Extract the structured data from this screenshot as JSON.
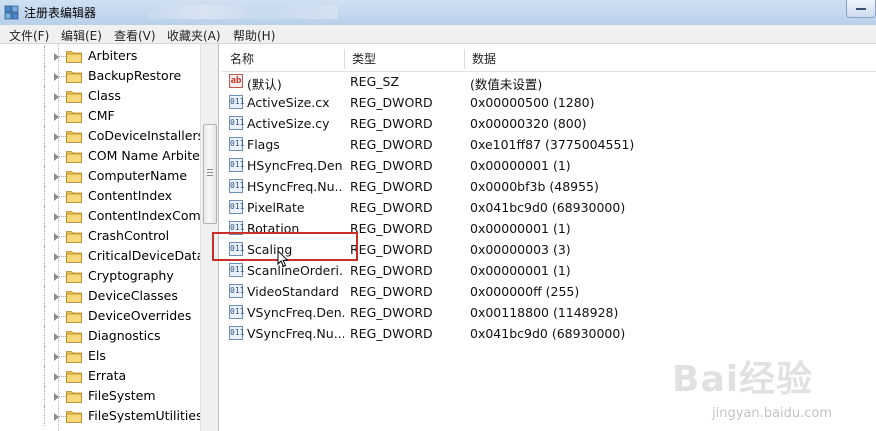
{
  "window": {
    "title": "注册表编辑器"
  },
  "menu": [
    {
      "label": "文件(F)"
    },
    {
      "label": "编辑(E)"
    },
    {
      "label": "查看(V)"
    },
    {
      "label": "收藏夹(A)"
    },
    {
      "label": "帮助(H)"
    }
  ],
  "tree": {
    "items": [
      {
        "label": "Arbiters"
      },
      {
        "label": "BackupRestore"
      },
      {
        "label": "Class"
      },
      {
        "label": "CMF"
      },
      {
        "label": "CoDeviceInstallers"
      },
      {
        "label": "COM Name Arbiter"
      },
      {
        "label": "ComputerName"
      },
      {
        "label": "ContentIndex"
      },
      {
        "label": "ContentIndexComm"
      },
      {
        "label": "CrashControl"
      },
      {
        "label": "CriticalDeviceDatab"
      },
      {
        "label": "Cryptography"
      },
      {
        "label": "DeviceClasses"
      },
      {
        "label": "DeviceOverrides"
      },
      {
        "label": "Diagnostics"
      },
      {
        "label": "Els"
      },
      {
        "label": "Errata"
      },
      {
        "label": "FileSystem"
      },
      {
        "label": "FileSystemUtilities"
      }
    ]
  },
  "list": {
    "columns": {
      "name": "名称",
      "type": "类型",
      "data": "数据"
    },
    "rows": [
      {
        "name": "(默认)",
        "type": "REG_SZ",
        "data": "(数值未设置)",
        "icon": "string-value-icon"
      },
      {
        "name": "ActiveSize.cx",
        "type": "REG_DWORD",
        "data": "0x00000500 (1280)",
        "icon": "binary-value-icon"
      },
      {
        "name": "ActiveSize.cy",
        "type": "REG_DWORD",
        "data": "0x00000320 (800)",
        "icon": "binary-value-icon"
      },
      {
        "name": "Flags",
        "type": "REG_DWORD",
        "data": "0xe101ff87 (3775004551)",
        "icon": "binary-value-icon"
      },
      {
        "name": "HSyncFreq.Den...",
        "type": "REG_DWORD",
        "data": "0x00000001 (1)",
        "icon": "binary-value-icon"
      },
      {
        "name": "HSyncFreq.Nu...",
        "type": "REG_DWORD",
        "data": "0x0000bf3b (48955)",
        "icon": "binary-value-icon"
      },
      {
        "name": "PixelRate",
        "type": "REG_DWORD",
        "data": "0x041bc9d0 (68930000)",
        "icon": "binary-value-icon"
      },
      {
        "name": "Rotation",
        "type": "REG_DWORD",
        "data": "0x00000001 (1)",
        "icon": "binary-value-icon"
      },
      {
        "name": "Scaling",
        "type": "REG_DWORD",
        "data": "0x00000003 (3)",
        "icon": "binary-value-icon"
      },
      {
        "name": "ScanlineOrderi...",
        "type": "REG_DWORD",
        "data": "0x00000001 (1)",
        "icon": "binary-value-icon"
      },
      {
        "name": "VideoStandard",
        "type": "REG_DWORD",
        "data": "0x000000ff (255)",
        "icon": "binary-value-icon"
      },
      {
        "name": "VSyncFreq.Den...",
        "type": "REG_DWORD",
        "data": "0x00118800 (1148928)",
        "icon": "binary-value-icon"
      },
      {
        "name": "VSyncFreq.Nu...",
        "type": "REG_DWORD",
        "data": "0x041bc9d0 (68930000)",
        "icon": "binary-value-icon"
      }
    ]
  },
  "watermark": {
    "brand": "Bai经验",
    "sub": "jingyan.baidu.com"
  },
  "colors": {
    "highlight": "#c9302c",
    "titlebar": "#c4d8ee"
  }
}
